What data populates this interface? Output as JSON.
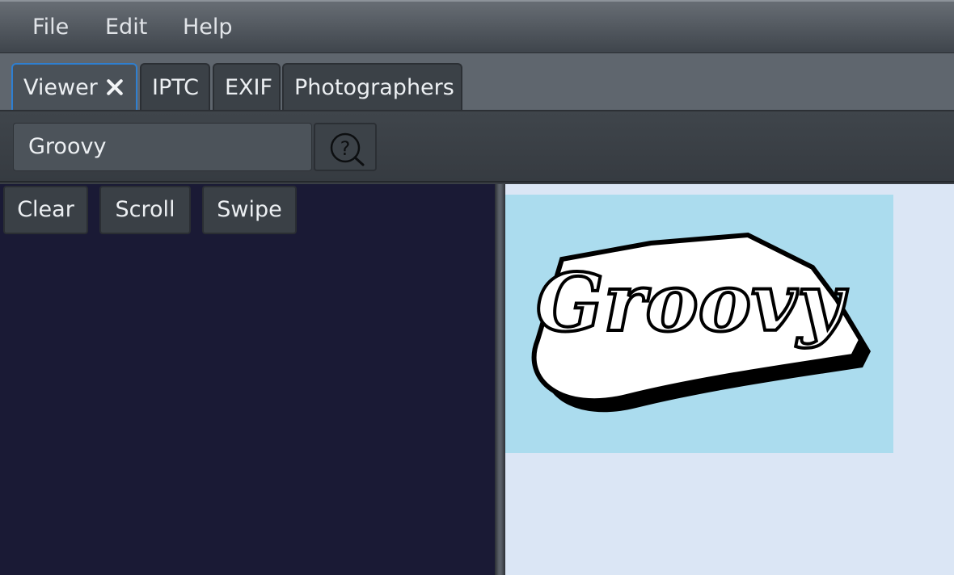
{
  "menu": {
    "file": "File",
    "edit": "Edit",
    "help": "Help"
  },
  "tabs": [
    {
      "label": "Viewer",
      "active": true,
      "closable": true
    },
    {
      "label": "IPTC",
      "active": false
    },
    {
      "label": "EXIF",
      "active": false
    },
    {
      "label": "Photographers",
      "active": false
    }
  ],
  "search": {
    "value": "Groovy",
    "help_icon": "question-magnifier-icon"
  },
  "actions": {
    "clear": "Clear",
    "scroll": "Scroll",
    "swipe": "Swipe"
  },
  "image": {
    "text": "Groovy",
    "background_color": "#abdcee"
  },
  "colors": {
    "active_tab_border": "#2e7fd1",
    "left_pane_bg": "#1a1a35",
    "right_pane_bg": "#dbe6f5"
  }
}
